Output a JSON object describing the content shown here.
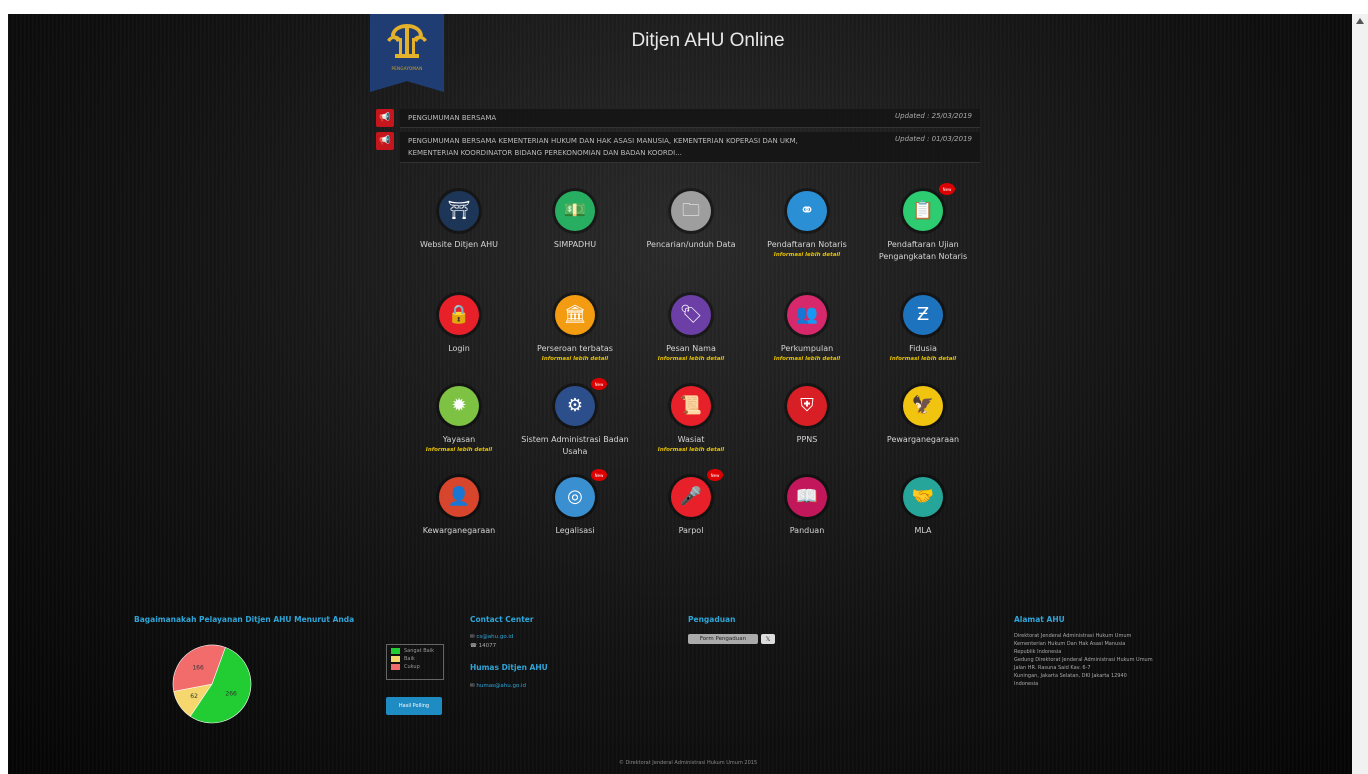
{
  "header": {
    "title": "Ditjen AHU Online",
    "logo_text": "PENGAYOMAN"
  },
  "announcements": [
    {
      "text": "PENGUMUMAN BERSAMA",
      "date": "Updated : 25/03/2019"
    },
    {
      "text": "PENGUMUMAN BERSAMA KEMENTERIAN HUKUM DAN HAK ASASI MANUSIA, KEMENTERIAN KOPERASI DAN UKM, KEMENTERIAN KOORDINATOR BIDANG PEREKONOMIAN DAN BADAN KOORDI...",
      "date": "Updated : 01/03/2019"
    }
  ],
  "services": [
    {
      "label": "Website Ditjen AHU",
      "info": "",
      "badge": "",
      "color": "#1d3557",
      "icon": "pengayoman-icon",
      "glyph": "⛩"
    },
    {
      "label": "SIMPADHU",
      "info": "",
      "badge": "",
      "color": "#27ae60",
      "icon": "money-icon",
      "glyph": "💵"
    },
    {
      "label": "Pencarian/unduh Data",
      "info": "",
      "badge": "",
      "color": "#9e9e9e",
      "icon": "folder-search-icon",
      "glyph": "🗀"
    },
    {
      "label": "Pendaftaran Notaris",
      "info": "Informasi lebih detail",
      "badge": "",
      "color": "#2b8fd6",
      "icon": "network-icon",
      "glyph": "⚭"
    },
    {
      "label": "Pendaftaran Ujian Pengangkatan Notaris",
      "info": "",
      "badge": "New",
      "color": "#2ecc71",
      "icon": "clipboard-icon",
      "glyph": "📋"
    },
    {
      "label": "Login",
      "info": "",
      "badge": "",
      "color": "#e8202a",
      "icon": "lock-icon",
      "glyph": "🔒"
    },
    {
      "label": "Perseroan terbatas",
      "info": "Informasi lebih detail",
      "badge": "",
      "color": "#f39c12",
      "icon": "bank-icon",
      "glyph": "🏛"
    },
    {
      "label": "Pesan Nama",
      "info": "Informasi lebih detail",
      "badge": "",
      "color": "#6c3fa6",
      "icon": "name-tag-icon",
      "glyph": "🏷"
    },
    {
      "label": "Perkumpulan",
      "info": "Informasi lebih detail",
      "badge": "",
      "color": "#d6286b",
      "icon": "people-icon",
      "glyph": "👥"
    },
    {
      "label": "Fidusia",
      "info": "Informasi lebih detail",
      "badge": "",
      "color": "#1e73be",
      "icon": "fidusia-icon",
      "glyph": "Ƶ"
    },
    {
      "label": "Yayasan",
      "info": "Informasi lebih detail",
      "badge": "",
      "color": "#7dc242",
      "icon": "gear-badge-icon",
      "glyph": "✹"
    },
    {
      "label": "Sistem Administrasi Badan Usaha",
      "info": "",
      "badge": "New",
      "color": "#2c4f8c",
      "icon": "gear-icon",
      "glyph": "⚙"
    },
    {
      "label": "Wasiat",
      "info": "Informasi lebih detail",
      "badge": "",
      "color": "#e8202a",
      "icon": "document-icon",
      "glyph": "📜"
    },
    {
      "label": "PPNS",
      "info": "",
      "badge": "",
      "color": "#d81f26",
      "icon": "shield-icon",
      "glyph": "⛨"
    },
    {
      "label": "Pewarganegaraan",
      "info": "",
      "badge": "",
      "color": "#f1c40f",
      "icon": "garuda-icon",
      "glyph": "🦅"
    },
    {
      "label": "Kewarganegaraan",
      "info": "",
      "badge": "",
      "color": "#d6452c",
      "icon": "person-icon",
      "glyph": "👤"
    },
    {
      "label": "Legalisasi",
      "info": "",
      "badge": "New",
      "color": "#3a8fd0",
      "icon": "fingerprint-icon",
      "glyph": "◎"
    },
    {
      "label": "Parpol",
      "info": "",
      "badge": "New",
      "color": "#e8202a",
      "icon": "podium-icon",
      "glyph": "🎤"
    },
    {
      "label": "Panduan",
      "info": "",
      "badge": "",
      "color": "#c2185b",
      "icon": "book-icon",
      "glyph": "📖"
    },
    {
      "label": "MLA",
      "info": "",
      "badge": "",
      "color": "#26a69a",
      "icon": "handshake-icon",
      "glyph": "🤝"
    }
  ],
  "survey": {
    "title": "Bagaimanakah Pelayanan Ditjen AHU Menurut Anda",
    "legend": [
      {
        "label": "Sangat Baik",
        "color": "#22cc33"
      },
      {
        "label": "Baik",
        "color": "#f5d76e"
      },
      {
        "label": "Cukup",
        "color": "#f26c6c"
      }
    ],
    "poll_button": "Hasil Polling"
  },
  "chart_data": {
    "type": "pie",
    "categories": [
      "Sangat Baik",
      "Baik",
      "Cukup"
    ],
    "values": [
      266,
      62,
      166
    ],
    "colors": [
      "#22cc33",
      "#f5d76e",
      "#f26c6c"
    ]
  },
  "contact": {
    "heading": "Contact Center",
    "email": "cs@ahu.go.id",
    "phone": "14077",
    "humas_heading": "Humas Ditjen AHU",
    "humas_email": "humas@ahu.go.id"
  },
  "complaint": {
    "heading": "Pengaduan",
    "form_button": "Form Pengaduan"
  },
  "address": {
    "heading": "Alamat AHU",
    "lines": [
      "Direktorat Jenderal Administrasi Hukum Umum",
      "Kementerian Hukum Dan Hak Asasi Manusia",
      "Republik Indonesia",
      "Gedung Direktorat Jenderal Administrasi Hukum Umum",
      "Jalan HR. Rasuna Said Kav. 6-7",
      "Kuningan, Jakarta Selatan, DKI Jakarta 12940",
      "Indonesia"
    ]
  },
  "footer": {
    "copyright": "© Direktorat Jenderal Administrasi Hukum Umum 2015"
  }
}
